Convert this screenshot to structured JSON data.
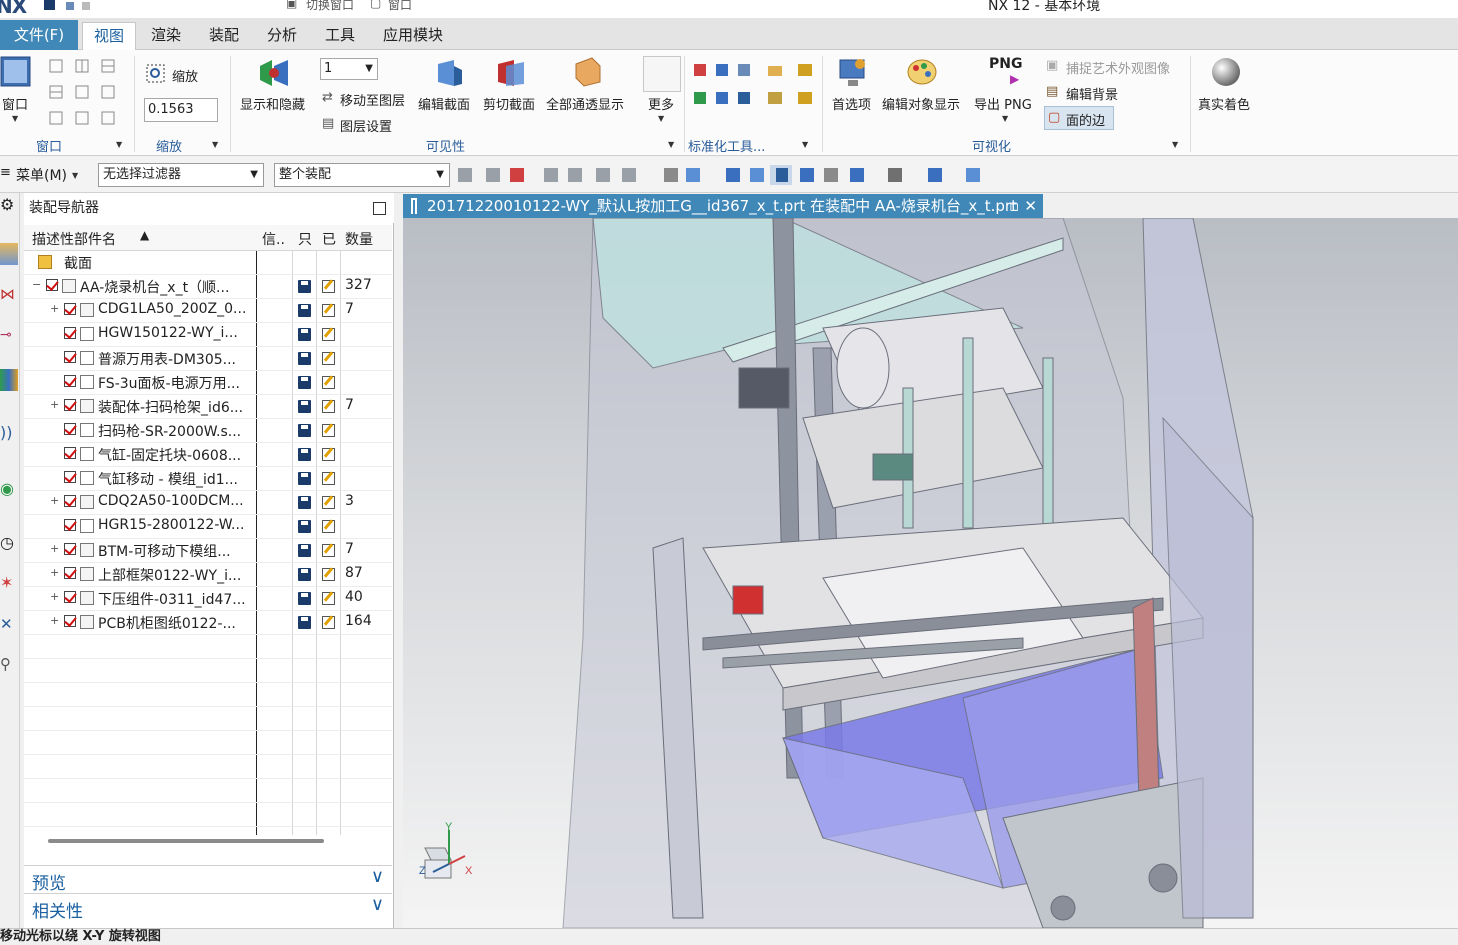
{
  "app": {
    "logo": "NX",
    "title": "NX 12 - 基本环境",
    "quick_access": [
      "切换窗口",
      "窗口"
    ]
  },
  "menu": {
    "file": "文件(F)",
    "tabs": [
      "视图",
      "渲染",
      "装配",
      "分析",
      "工具",
      "应用模块"
    ],
    "active_tab": "视图"
  },
  "ribbon": {
    "window": {
      "label": "窗口",
      "group": "窗口"
    },
    "zoom": {
      "label": "缩放",
      "value": "0.1563",
      "group": "缩放"
    },
    "visibility": {
      "show_hide": "显示和隐藏",
      "layer_value": "1",
      "move_to_layer": "移动至图层",
      "layer_settings": "图层设置",
      "edit_section": "编辑截面",
      "clip_section": "剪切截面",
      "show_all_transparent": "全部通透显示",
      "more": "更多",
      "group": "可见性"
    },
    "standard_tools": {
      "group": "标准化工具..."
    },
    "visualization": {
      "preferences": "首选项",
      "edit_object_display": "编辑对象显示",
      "png_badge": "PNG",
      "export_png": "导出 PNG",
      "capture_art": "捕捉艺术外观图像",
      "edit_background": "编辑背景",
      "face_edges": "面的边",
      "group": "可视化"
    },
    "true_shading": "真实着色"
  },
  "selection_bar": {
    "menu": "菜单(M)",
    "filter": "无选择过滤器",
    "scope": "整个装配"
  },
  "navigator": {
    "title": "装配导航器",
    "columns": {
      "name": "描述性部件名",
      "info": "信..",
      "read_only": "只",
      "modified": "已",
      "quantity": "数量"
    },
    "sections_label": "截面",
    "rows": [
      {
        "name": "AA-烧录机台_x_t（顺...",
        "qty": "327",
        "level": 0,
        "expander": "−",
        "assembly": true
      },
      {
        "name": "CDG1LA50_200Z_0...",
        "qty": "7",
        "level": 1,
        "expander": "+",
        "assembly": true
      },
      {
        "name": "HGW150122-WY_i...",
        "qty": "",
        "level": 1,
        "expander": "",
        "assembly": false
      },
      {
        "name": "普源万用表-DM305...",
        "qty": "",
        "level": 1,
        "expander": "",
        "assembly": false
      },
      {
        "name": "FS-3u面板-电源万用...",
        "qty": "",
        "level": 1,
        "expander": "",
        "assembly": false
      },
      {
        "name": "装配体-扫码枪架_id6...",
        "qty": "7",
        "level": 1,
        "expander": "+",
        "assembly": true
      },
      {
        "name": "扫码枪-SR-2000W.s...",
        "qty": "",
        "level": 1,
        "expander": "",
        "assembly": false
      },
      {
        "name": "气缸-固定托块-0608...",
        "qty": "",
        "level": 1,
        "expander": "",
        "assembly": false
      },
      {
        "name": "气缸移动 -  模组_id1...",
        "qty": "",
        "level": 1,
        "expander": "",
        "assembly": false
      },
      {
        "name": "CDQ2A50-100DCM...",
        "qty": "3",
        "level": 1,
        "expander": "+",
        "assembly": true
      },
      {
        "name": "HGR15-2800122-W...",
        "qty": "",
        "level": 1,
        "expander": "",
        "assembly": false
      },
      {
        "name": "BTM-可移动下模组...",
        "qty": "7",
        "level": 1,
        "expander": "+",
        "assembly": true
      },
      {
        "name": "上部框架0122-WY_i...",
        "qty": "87",
        "level": 1,
        "expander": "+",
        "assembly": true
      },
      {
        "name": "下压组件-0311_id47...",
        "qty": "40",
        "level": 1,
        "expander": "+",
        "assembly": true
      },
      {
        "name": "PCB机柜图纸0122-...",
        "qty": "164",
        "level": 1,
        "expander": "+",
        "assembly": true
      }
    ],
    "preview": "预览",
    "dependencies": "相关性"
  },
  "graphics": {
    "tab_title": "20171220010122-WY_默认L按加工G__id367_x_t.prt 在装配中 AA-烧录机台_x_t.prt",
    "triad": {
      "x": "X",
      "y": "Y",
      "z": "Z"
    }
  },
  "status": "移动光标以绕 X-Y 旋转视图"
}
